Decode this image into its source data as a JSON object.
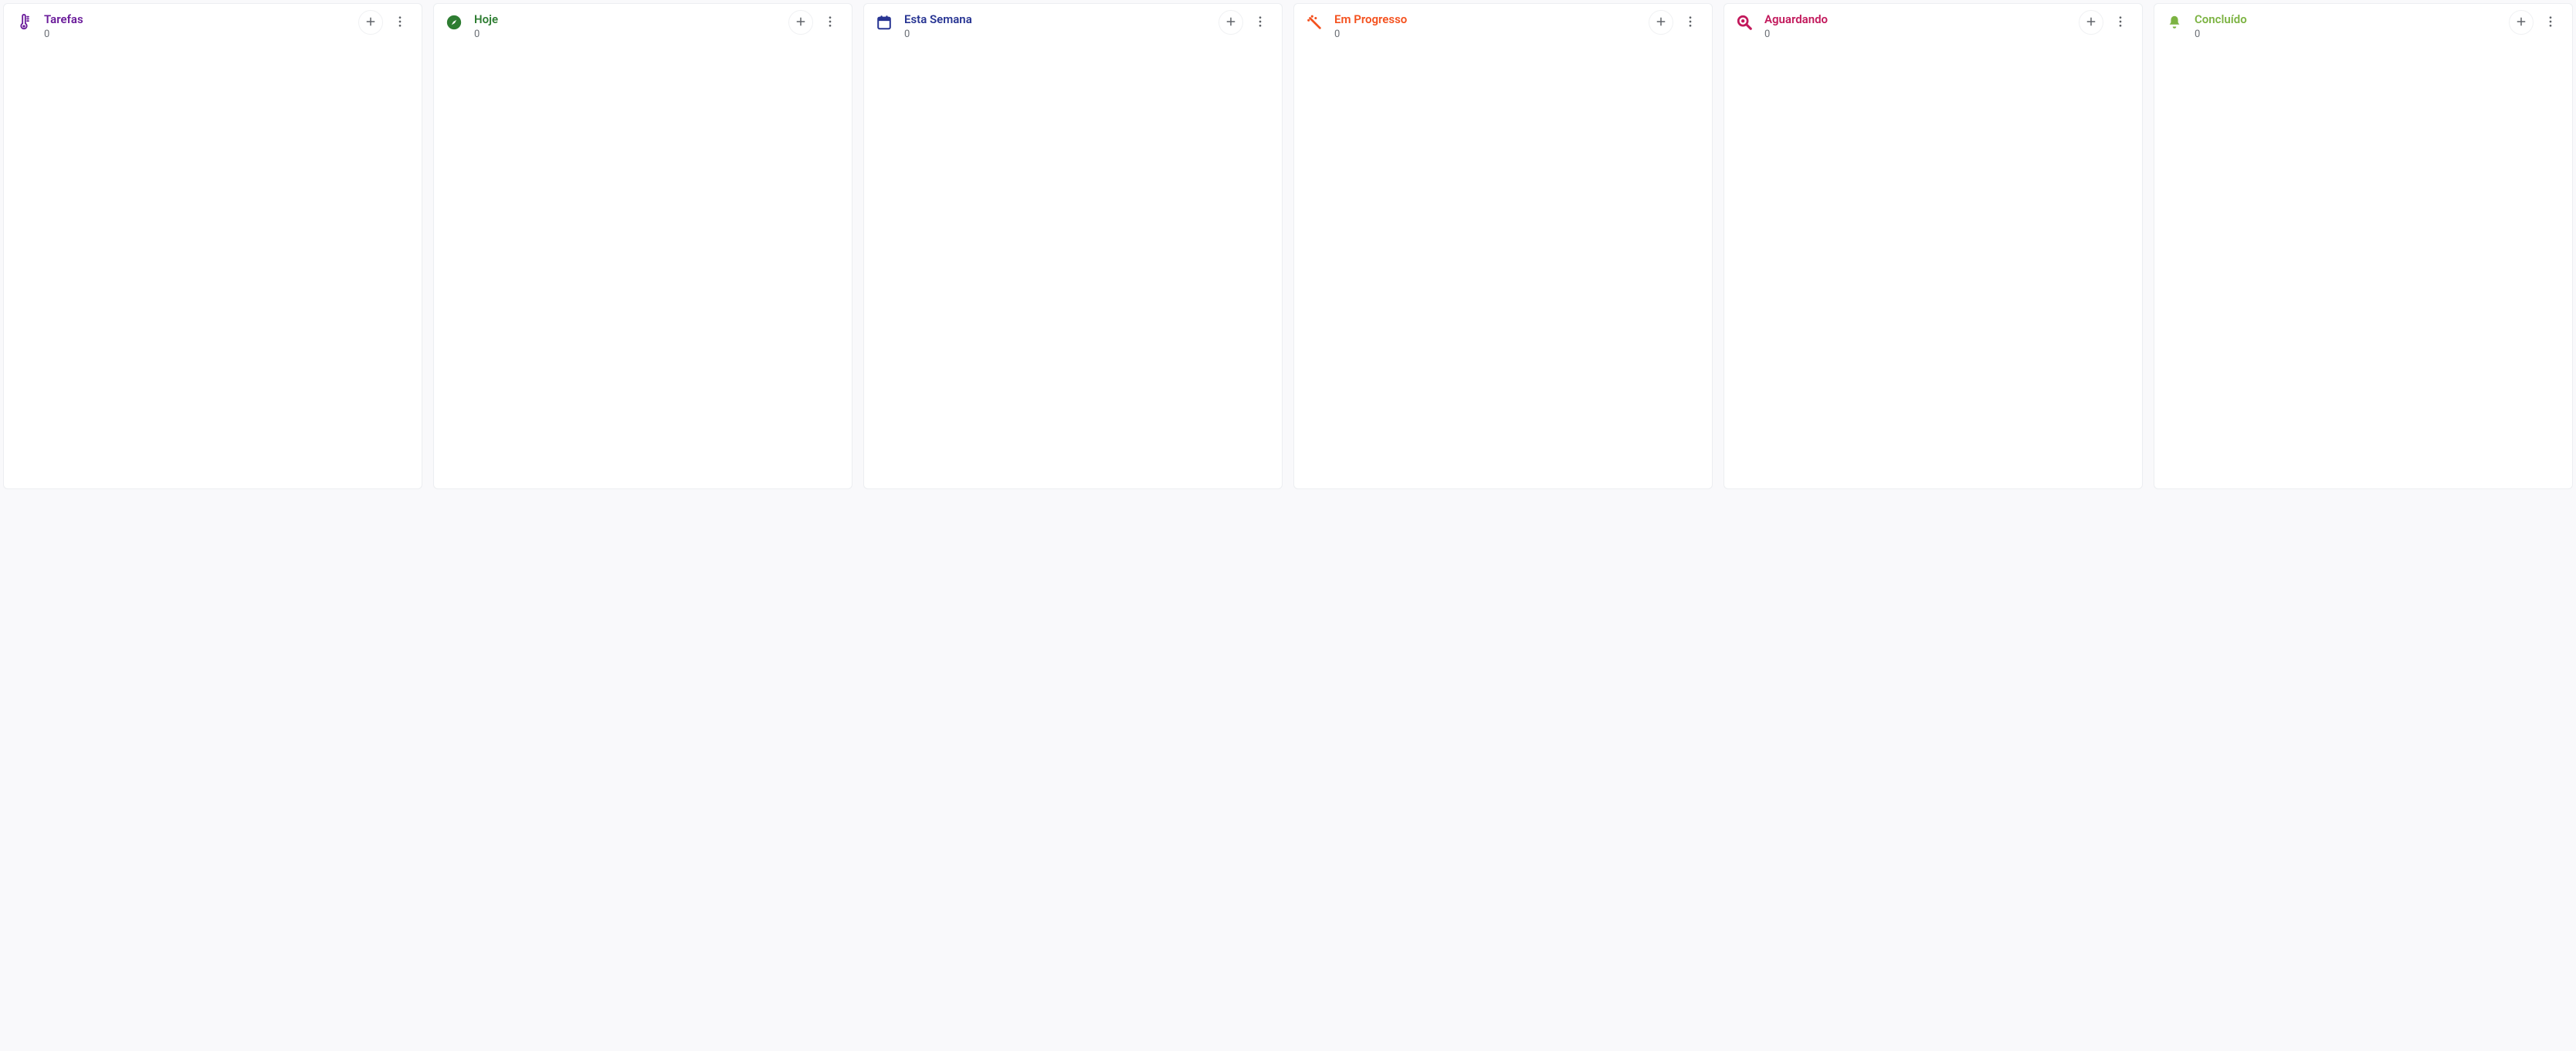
{
  "columns": [
    {
      "id": "tarefas",
      "title": "Tarefas",
      "count": "0",
      "color": "#6a1b9a",
      "icon": "thermometer"
    },
    {
      "id": "hoje",
      "title": "Hoje",
      "count": "0",
      "color": "#2e7d32",
      "icon": "compass"
    },
    {
      "id": "esta-semana",
      "title": "Esta Semana",
      "count": "0",
      "color": "#283593",
      "icon": "calendar"
    },
    {
      "id": "em-progresso",
      "title": "Em Progresso",
      "count": "0",
      "color": "#f4511e",
      "icon": "wand"
    },
    {
      "id": "aguardando",
      "title": "Aguardando",
      "count": "0",
      "color": "#c2185b",
      "icon": "magnifier"
    },
    {
      "id": "concluido",
      "title": "Concluído",
      "count": "0",
      "color": "#7cb342",
      "icon": "bell"
    }
  ]
}
